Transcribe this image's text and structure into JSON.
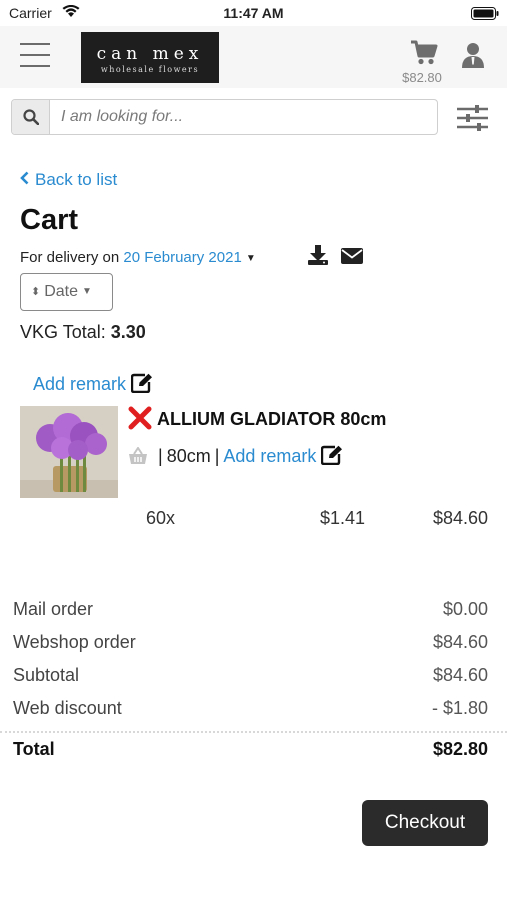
{
  "status_bar": {
    "carrier": "Carrier",
    "time": "11:47 AM"
  },
  "header": {
    "logo_name": "can mex",
    "logo_tagline": "wholesale flowers",
    "cart_total": "$82.80"
  },
  "search": {
    "placeholder": "I am looking for..."
  },
  "nav": {
    "back_label": "Back to list"
  },
  "page": {
    "title": "Cart",
    "delivery_prefix": "For delivery on",
    "delivery_date": "20 February 2021",
    "sort_label": "Date",
    "vkg_label": "VKG Total:",
    "vkg_value": "3.30",
    "add_remark_label": "Add remark"
  },
  "item": {
    "name": "ALLIUM GLADIATOR 80cm",
    "size": "80cm",
    "remark_label": "Add remark",
    "quantity": "60x",
    "unit_price": "$1.41",
    "line_total": "$84.60"
  },
  "summary": {
    "rows": [
      {
        "label": "Mail order",
        "value": "$0.00"
      },
      {
        "label": "Webshop order",
        "value": "$84.60"
      },
      {
        "label": "Subtotal",
        "value": "$84.60"
      },
      {
        "label": "Web discount",
        "value": "- $1.80"
      }
    ],
    "total_label": "Total",
    "total_value": "$82.80"
  },
  "actions": {
    "checkout_label": "Checkout"
  },
  "colors": {
    "link": "#2a8bd0",
    "remove": "#e02020",
    "button": "#2b2b2b"
  },
  "icons": [
    "wifi-icon",
    "battery-icon",
    "menu-icon",
    "cart-icon",
    "user-icon",
    "search-icon",
    "filter-icon",
    "chevron-left-icon",
    "download-icon",
    "mail-icon",
    "sort-icon",
    "edit-icon",
    "remove-icon",
    "basket-icon"
  ]
}
